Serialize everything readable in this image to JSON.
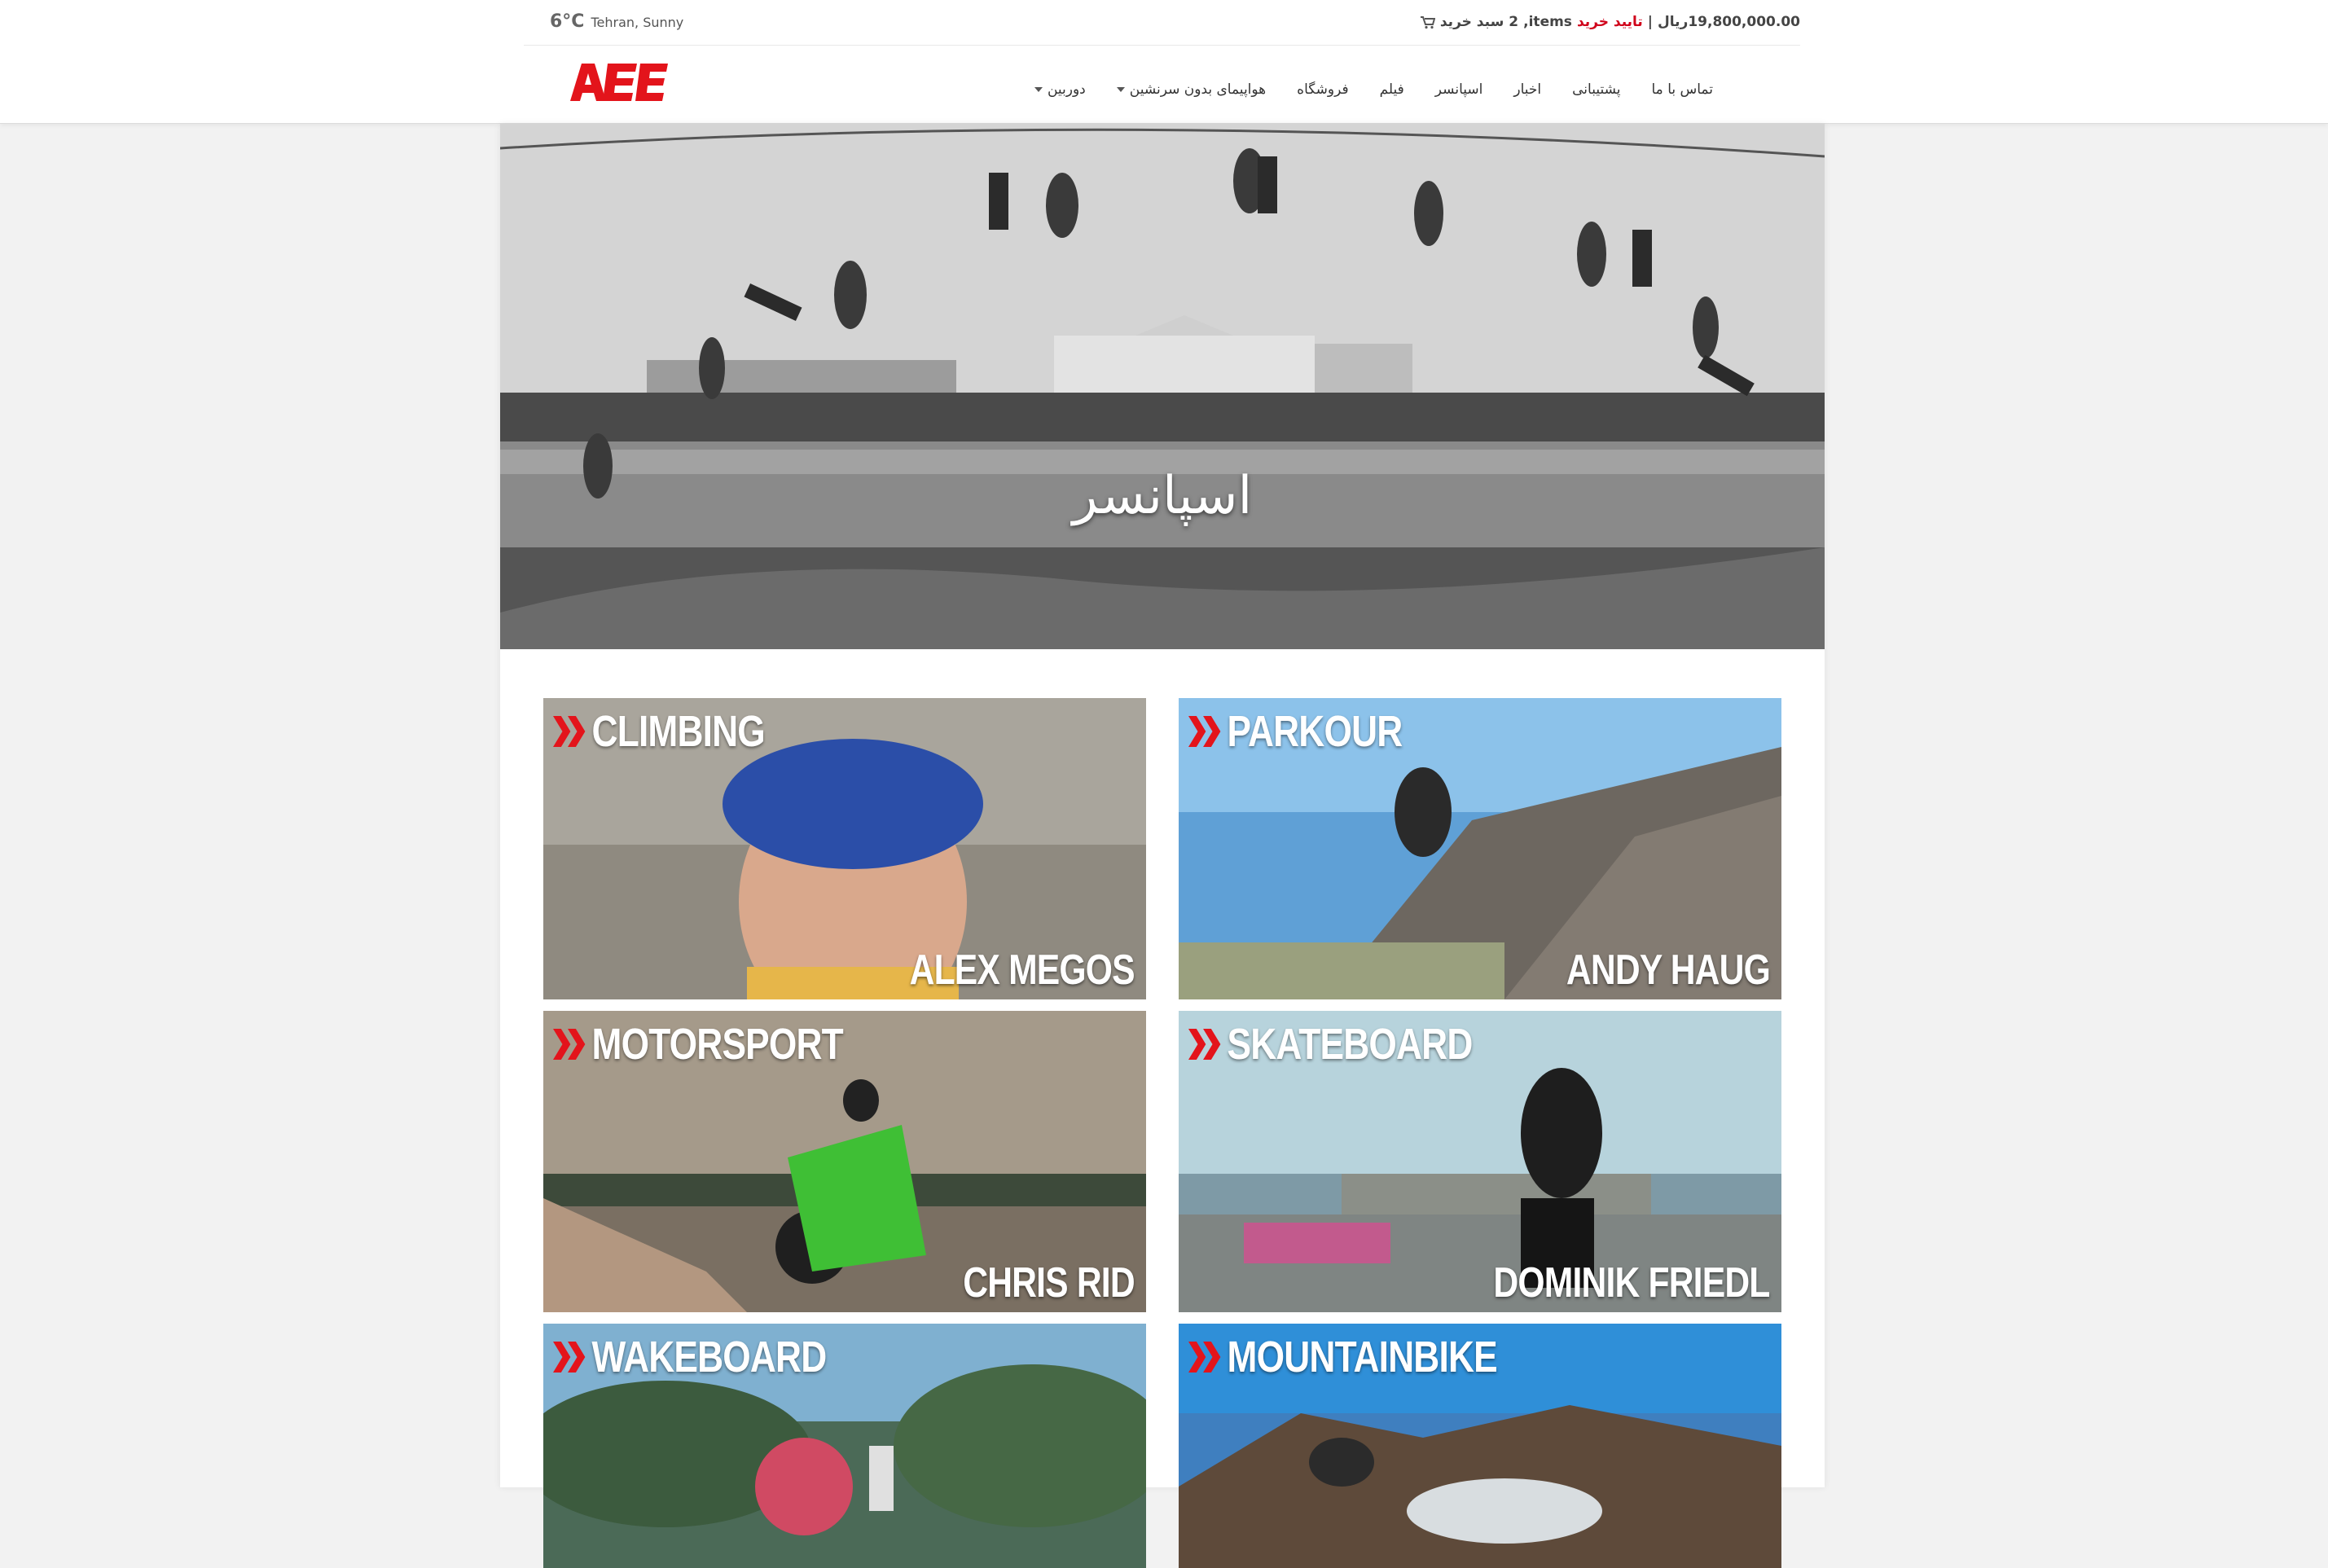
{
  "topbar": {
    "temperature": "6°C",
    "location": "Tehran,  Sunny",
    "cart_label": "سبد خرید",
    "cart_count": "2",
    "cart_items": "items,",
    "checkout_label": "تایید خرید",
    "separator": "|",
    "cart_total": "19,800,000.00ریال"
  },
  "logo": {
    "text": "AEE",
    "color": "#e3141b"
  },
  "nav": {
    "items": [
      {
        "label": "دوربین",
        "has_dropdown": true
      },
      {
        "label": "هواپیمای بدون سرنشین",
        "has_dropdown": true
      },
      {
        "label": "فروشگاه",
        "has_dropdown": false
      },
      {
        "label": "فیلم",
        "has_dropdown": false
      },
      {
        "label": "اسپانسر",
        "has_dropdown": false
      },
      {
        "label": "اخبار",
        "has_dropdown": false
      },
      {
        "label": "پشتیبانی",
        "has_dropdown": false
      },
      {
        "label": "تماس با ما",
        "has_dropdown": false
      }
    ]
  },
  "hero": {
    "title": "اسپانسر"
  },
  "tiles": [
    {
      "category": "CLIMBING",
      "athlete": "ALEX MEGOS"
    },
    {
      "category": "PARKOUR",
      "athlete": "ANDY HAUG"
    },
    {
      "category": "MOTORSPORT",
      "athlete": "CHRIS RID"
    },
    {
      "category": "SKATEBOARD",
      "athlete": "DOMINIK FRIEDL"
    },
    {
      "category": "WAKEBOARD",
      "athlete": ""
    },
    {
      "category": "MOUNTAINBIKE",
      "athlete": ""
    }
  ],
  "colors": {
    "accent": "#e3141b",
    "checkout": "#d0021b"
  }
}
